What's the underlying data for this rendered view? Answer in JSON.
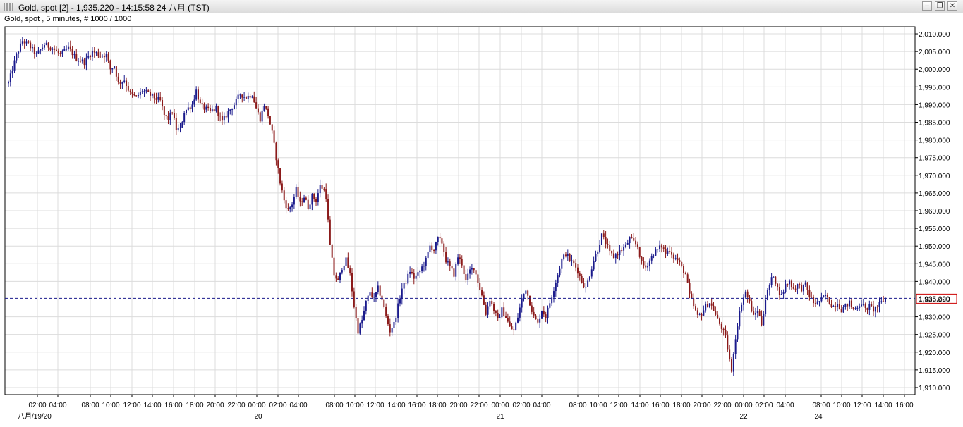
{
  "window": {
    "title": "Gold, spot [2] - 1,935.220 - 14:15:58  24 八月 (TST)",
    "subtitle": "Gold, spot , 5 minutes, # 1000 / 1000",
    "buttons": {
      "minimize": "–",
      "restore": "❐",
      "close": "✕"
    }
  },
  "chart_data": {
    "type": "candlestick",
    "title": "",
    "ylim": [
      1908,
      2012
    ],
    "y_ticks": [
      2010,
      2005,
      2000,
      1995,
      1990,
      1985,
      1980,
      1975,
      1970,
      1965,
      1960,
      1955,
      1950,
      1945,
      1940,
      1935,
      1930,
      1925,
      1920,
      1915,
      1910
    ],
    "y_tick_labels": [
      "2,010.000",
      "2,005.000",
      "2,000.000",
      "1,995.000",
      "1,990.000",
      "1,985.000",
      "1,980.000",
      "1,975.000",
      "1,970.000",
      "1,965.000",
      "1,960.000",
      "1,955.000",
      "1,950.000",
      "1,945.000",
      "1,940.000",
      "1,935.000",
      "1,930.000",
      "1,925.000",
      "1,920.000",
      "1,915.000",
      "1,910.000"
    ],
    "x_tick_labels": [
      "02:00",
      "04:00",
      "08:00",
      "10:00",
      "12:00",
      "14:00",
      "16:00",
      "18:00",
      "20:00",
      "22:00",
      "00:00",
      "02:00",
      "04:00",
      "08:00",
      "10:00",
      "12:00",
      "14:00",
      "16:00",
      "18:00",
      "20:00",
      "22:00",
      "00:00",
      "02:00",
      "04:00",
      "08:00",
      "10:00",
      "12:00",
      "14:00",
      "16:00",
      "18:00",
      "20:00",
      "22:00",
      "00:00",
      "02:00",
      "04:00",
      "08:00",
      "10:00",
      "12:00",
      "14:00",
      "16:00"
    ],
    "date_labels": [
      "八月/19/20",
      "20",
      "21",
      "22",
      "24"
    ],
    "last_price": 1935.22,
    "last_price_label": "1,935.220",
    "colors": {
      "up": "#1a1a8c",
      "down": "#8b1a1a",
      "last_line": "#1a1a8c",
      "grid": "#dcdcdc",
      "last_box": "#cc0000"
    },
    "grid": true,
    "path_anchors": [
      [
        0,
        1996
      ],
      [
        2,
        2000
      ],
      [
        4,
        2004
      ],
      [
        7,
        2008
      ],
      [
        10,
        2007
      ],
      [
        14,
        2004
      ],
      [
        18,
        2007
      ],
      [
        22,
        2006
      ],
      [
        26,
        2004
      ],
      [
        30,
        2006
      ],
      [
        34,
        2003
      ],
      [
        38,
        2002
      ],
      [
        42,
        2005
      ],
      [
        46,
        2004
      ],
      [
        49,
        2004
      ],
      [
        51,
        2000
      ],
      [
        53,
        2001
      ],
      [
        55,
        1996
      ],
      [
        58,
        1997
      ],
      [
        61,
        1993
      ],
      [
        64,
        1992
      ],
      [
        67,
        1994
      ],
      [
        70,
        1993
      ],
      [
        73,
        1992
      ],
      [
        76,
        1991
      ],
      [
        78,
        1987
      ],
      [
        80,
        1986
      ],
      [
        82,
        1988
      ],
      [
        84,
        1983
      ],
      [
        86,
        1983
      ],
      [
        88,
        1988
      ],
      [
        90,
        1989
      ],
      [
        92,
        1990
      ],
      [
        94,
        1994
      ],
      [
        96,
        1990
      ],
      [
        98,
        1989
      ],
      [
        101,
        1988
      ],
      [
        104,
        1989
      ],
      [
        107,
        1985
      ],
      [
        110,
        1988
      ],
      [
        113,
        1990
      ],
      [
        116,
        1993
      ],
      [
        119,
        1992
      ],
      [
        122,
        1993
      ],
      [
        124,
        1989
      ],
      [
        126,
        1986
      ],
      [
        128,
        1990
      ],
      [
        130,
        1987
      ],
      [
        132,
        1982
      ],
      [
        134,
        1975
      ],
      [
        136,
        1968
      ],
      [
        138,
        1963
      ],
      [
        140,
        1960
      ],
      [
        142,
        1962
      ],
      [
        144,
        1966
      ],
      [
        146,
        1962
      ],
      [
        148,
        1964
      ],
      [
        150,
        1961
      ],
      [
        152,
        1964
      ],
      [
        154,
        1963
      ],
      [
        156,
        1967
      ],
      [
        158,
        1966
      ],
      [
        159,
        1964
      ],
      [
        161,
        1950
      ],
      [
        163,
        1942
      ],
      [
        165,
        1940
      ],
      [
        167,
        1944
      ],
      [
        169,
        1946
      ],
      [
        171,
        1942
      ],
      [
        173,
        1933
      ],
      [
        175,
        1926
      ],
      [
        177,
        1929
      ],
      [
        179,
        1934
      ],
      [
        181,
        1937
      ],
      [
        183,
        1935
      ],
      [
        185,
        1938
      ],
      [
        187,
        1935
      ],
      [
        189,
        1930
      ],
      [
        191,
        1926
      ],
      [
        193,
        1928
      ],
      [
        195,
        1933
      ],
      [
        197,
        1938
      ],
      [
        199,
        1940
      ],
      [
        201,
        1943
      ],
      [
        203,
        1941
      ],
      [
        205,
        1942
      ],
      [
        207,
        1944
      ],
      [
        209,
        1946
      ],
      [
        211,
        1950
      ],
      [
        213,
        1949
      ],
      [
        215,
        1952
      ],
      [
        217,
        1951
      ],
      [
        219,
        1946
      ],
      [
        221,
        1944
      ],
      [
        223,
        1942
      ],
      [
        225,
        1947
      ],
      [
        227,
        1945
      ],
      [
        229,
        1940
      ],
      [
        231,
        1943
      ],
      [
        233,
        1944
      ],
      [
        235,
        1940
      ],
      [
        237,
        1936
      ],
      [
        239,
        1931
      ],
      [
        241,
        1935
      ],
      [
        243,
        1932
      ],
      [
        245,
        1929
      ],
      [
        247,
        1932
      ],
      [
        249,
        1930
      ],
      [
        251,
        1927
      ],
      [
        253,
        1926
      ],
      [
        255,
        1930
      ],
      [
        257,
        1935
      ],
      [
        259,
        1938
      ],
      [
        261,
        1934
      ],
      [
        263,
        1930
      ],
      [
        265,
        1928
      ],
      [
        267,
        1932
      ],
      [
        269,
        1930
      ],
      [
        271,
        1934
      ],
      [
        273,
        1938
      ],
      [
        275,
        1942
      ],
      [
        277,
        1946
      ],
      [
        279,
        1948
      ],
      [
        281,
        1946
      ],
      [
        283,
        1945
      ],
      [
        285,
        1943
      ],
      [
        287,
        1940
      ],
      [
        289,
        1938
      ],
      [
        291,
        1942
      ],
      [
        293,
        1946
      ],
      [
        295,
        1949
      ],
      [
        297,
        1953
      ],
      [
        299,
        1951
      ],
      [
        301,
        1948
      ],
      [
        303,
        1947
      ],
      [
        305,
        1948
      ],
      [
        307,
        1949
      ],
      [
        309,
        1950
      ],
      [
        311,
        1952
      ],
      [
        313,
        1951
      ],
      [
        315,
        1950
      ],
      [
        317,
        1945
      ],
      [
        319,
        1944
      ],
      [
        321,
        1946
      ],
      [
        323,
        1948
      ],
      [
        325,
        1949
      ],
      [
        327,
        1950
      ],
      [
        329,
        1948
      ],
      [
        331,
        1949
      ],
      [
        333,
        1947
      ],
      [
        335,
        1946
      ],
      [
        337,
        1944
      ],
      [
        339,
        1942
      ],
      [
        341,
        1936
      ],
      [
        343,
        1933
      ],
      [
        345,
        1930
      ],
      [
        347,
        1931
      ],
      [
        349,
        1933
      ],
      [
        351,
        1934
      ],
      [
        353,
        1932
      ],
      [
        355,
        1929
      ],
      [
        357,
        1927
      ],
      [
        359,
        1924
      ],
      [
        361,
        1918
      ],
      [
        362,
        1914
      ],
      [
        363,
        1920
      ],
      [
        365,
        1928
      ],
      [
        367,
        1934
      ],
      [
        369,
        1937
      ],
      [
        371,
        1934
      ],
      [
        373,
        1930
      ],
      [
        375,
        1932
      ],
      [
        377,
        1928
      ],
      [
        379,
        1935
      ],
      [
        381,
        1939
      ],
      [
        383,
        1942
      ],
      [
        385,
        1938
      ],
      [
        387,
        1936
      ],
      [
        389,
        1939
      ],
      [
        391,
        1940
      ],
      [
        393,
        1938
      ],
      [
        395,
        1939
      ],
      [
        397,
        1938
      ],
      [
        399,
        1939
      ],
      [
        401,
        1936
      ],
      [
        403,
        1934
      ],
      [
        405,
        1934
      ],
      [
        407,
        1935
      ],
      [
        409,
        1936
      ],
      [
        411,
        1934
      ],
      [
        413,
        1933
      ],
      [
        415,
        1934
      ],
      [
        417,
        1932
      ],
      [
        419,
        1933
      ],
      [
        421,
        1934
      ],
      [
        423,
        1932
      ],
      [
        425,
        1933
      ],
      [
        427,
        1934
      ],
      [
        429,
        1932
      ],
      [
        431,
        1933
      ],
      [
        433,
        1932
      ],
      [
        435,
        1933
      ],
      [
        437,
        1934
      ],
      [
        439,
        1935.22
      ]
    ]
  }
}
